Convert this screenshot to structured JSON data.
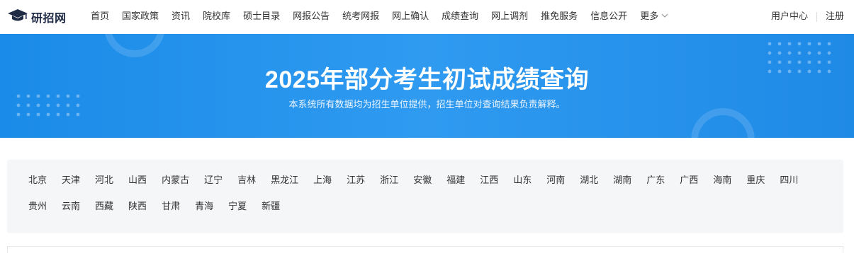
{
  "header": {
    "logo_text": "研招网",
    "nav": [
      "首页",
      "国家政策",
      "资讯",
      "院校库",
      "硕士目录",
      "网报公告",
      "统考网报",
      "网上确认",
      "成绩查询",
      "网上调剂",
      "推免服务",
      "信息公开"
    ],
    "more_label": "更多",
    "user_center": "用户中心",
    "register": "注册"
  },
  "banner": {
    "title": "2025年部分考生初试成绩查询",
    "subtitle": "本系统所有数据均为招生单位提供，招生单位对查询结果负责解释。"
  },
  "provinces": {
    "row1": [
      "北京",
      "天津",
      "河北",
      "山西",
      "内蒙古",
      "辽宁",
      "吉林",
      "黑龙江",
      "上海",
      "江苏",
      "浙江",
      "安徽",
      "福建",
      "江西",
      "山东",
      "河南",
      "湖北",
      "湖南",
      "广东",
      "广西",
      "海南",
      "重庆",
      "四川"
    ],
    "row2": [
      "贵州",
      "云南",
      "西藏",
      "陕西",
      "甘肃",
      "青海",
      "宁夏",
      "新疆"
    ]
  },
  "icons": {
    "logo": "graduation-cap-icon",
    "more": "chevron-down-icon"
  },
  "colors": {
    "banner_blue": "#1f8ae6",
    "panel_bg": "#f5f6f8"
  }
}
